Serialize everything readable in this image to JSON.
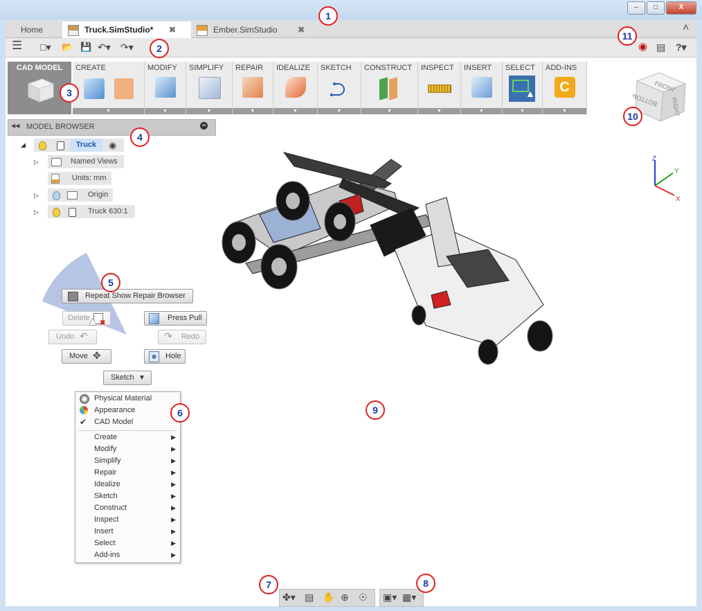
{
  "window": {
    "minimize": "–",
    "maximize": "□",
    "close": "X"
  },
  "tabs": [
    {
      "label": "Home"
    },
    {
      "label": "Truck.SimStudio*",
      "close": "✖"
    },
    {
      "label": "Ember.SimStudio",
      "close": "✖"
    }
  ],
  "tabbar": {
    "collapse": "˄"
  },
  "qat": {
    "menu": "☰",
    "new": "□▾",
    "open": "📂",
    "save": "💾",
    "undo": "↶▾",
    "redo": "↷▾",
    "record": "◉",
    "comments": "▤",
    "help": "?▾"
  },
  "toolbar": {
    "workspace": "CAD MODEL",
    "panels": [
      {
        "label": "CREATE"
      },
      {
        "label": "MODIFY"
      },
      {
        "label": "SIMPLIFY"
      },
      {
        "label": "REPAIR"
      },
      {
        "label": "IDEALIZE"
      },
      {
        "label": "SKETCH"
      },
      {
        "label": "CONSTRUCT"
      },
      {
        "label": "INSPECT"
      },
      {
        "label": "INSERT"
      },
      {
        "label": "SELECT"
      },
      {
        "label": "ADD-INS"
      }
    ],
    "dropdown_glyph": "▼",
    "colors": {
      "workspace_bg": "#8d8d8d",
      "panel_bg": "#ececec",
      "select_accent": "#3a70b0",
      "addins_accent": "#f2a91a"
    }
  },
  "browser": {
    "title": "MODEL BROWSER",
    "collapse": "◀◀",
    "minus": "−",
    "root": {
      "label": "Truck",
      "radio": "◉"
    },
    "items": [
      {
        "label": "Named Views"
      },
      {
        "label": "Units: mm"
      },
      {
        "label": "Origin"
      },
      {
        "label": "Truck 630:1"
      }
    ],
    "expand_glyph": "▷",
    "root_expand_glyph": "◢"
  },
  "marking_menu": {
    "repeat": "Repeat Show Repair Browser",
    "delete": "Delete",
    "press_pull": "Press Pull",
    "undo": "Undo",
    "redo": "Redo",
    "move": "Move",
    "hole": "Hole",
    "sketch": "Sketch",
    "sketch_arrow": "▼"
  },
  "context_menu": {
    "top_items": [
      {
        "label": "Physical Material",
        "icon": "material-icon"
      },
      {
        "label": "Appearance",
        "icon": "appearance-icon"
      },
      {
        "label": "CAD Model",
        "icon": "check-icon",
        "check": "✔"
      }
    ],
    "submenus": [
      {
        "label": "Create"
      },
      {
        "label": "Modify"
      },
      {
        "label": "Simplify"
      },
      {
        "label": "Repair"
      },
      {
        "label": "Idealize"
      },
      {
        "label": "Sketch"
      },
      {
        "label": "Construct"
      },
      {
        "label": "Inspect"
      },
      {
        "label": "Insert"
      },
      {
        "label": "Select"
      },
      {
        "label": "Add-ins"
      }
    ],
    "arrow": "▶"
  },
  "viewcube": {
    "front": "FRONT",
    "right": "RIGHT",
    "bottom": "BOTTOM"
  },
  "axes": {
    "x": "X",
    "y": "Y",
    "z": "Z",
    "x_color": "#e03030",
    "y_color": "#2aa02a",
    "z_color": "#2a3ad0"
  },
  "navbar": {
    "orbit": "✤▾",
    "look": "▤",
    "pan": "✋",
    "zoom": "⊕",
    "fit": "☉"
  },
  "displaybar": {
    "display": "▣▾",
    "grid": "▦▾"
  },
  "callouts": [
    "1",
    "2",
    "3",
    "4",
    "5",
    "6",
    "7",
    "8",
    "9",
    "10",
    "11"
  ]
}
